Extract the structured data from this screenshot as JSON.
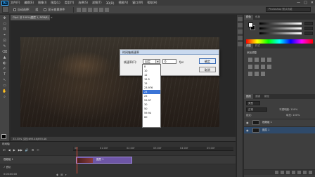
{
  "app": {
    "logo": "Ps"
  },
  "menu": [
    "文件(F)",
    "编辑(E)",
    "图像(I)",
    "图层(L)",
    "类型(Y)",
    "选择(S)",
    "滤镜(T)",
    "3D(D)",
    "视图(V)",
    "窗口(W)",
    "帮助(H)"
  ],
  "window_controls": {
    "min": "—",
    "max": "□",
    "close": "✕"
  },
  "options": {
    "auto_select_label": "自动选择:",
    "auto_select_value": "组",
    "transform_label": "显示变换控件"
  },
  "workspace": "Photoshop 默认功能",
  "document": {
    "tab": "Clip1 @ 100%(图层 1, RGB/8)",
    "close": "×"
  },
  "dialog": {
    "title": "时间轴帧速率",
    "label": "帧速率(F):",
    "select_value": "自定",
    "input_value": "6",
    "unit": "fps",
    "ok": "确定",
    "cancel": "取消"
  },
  "dropdown": {
    "options": [
      "8",
      "10",
      "12",
      "12.5",
      "15",
      "23.976",
      "24",
      "25",
      "29.97",
      "30",
      "50",
      "59.94",
      "60"
    ],
    "selected_index": 6
  },
  "status": "33.33%  文档:693.4K/693.4K",
  "timeline": {
    "tab": "时间轴",
    "controls": [
      "⏮",
      "◀",
      "▶",
      "▶▶",
      "🔊",
      "⚙",
      "✂"
    ],
    "ruler": [
      "00",
      "01:00f",
      "02:00f",
      "03:00f",
      "04:00f",
      "05:00f"
    ],
    "track": "视频组 1",
    "clip": "图层 1",
    "audio": "♪ 音轨",
    "time": "0:00:00:00",
    "bottom_icons": [
      "◈",
      "⊞",
      "⌕"
    ]
  },
  "panels": {
    "color_tabs": [
      "颜色",
      "色板"
    ],
    "adj_tabs": [
      "调整",
      "样式"
    ],
    "adj_title": "添加调整",
    "layer_tabs": [
      "图层",
      "通道",
      "路径"
    ],
    "layer_kind": "类型",
    "layer_mode": "正常",
    "layer_opacity": "不透明度: 100%",
    "layer_lock": "锁定:",
    "layer_fill": "填充: 100%",
    "layers": [
      {
        "name": "视频组 1",
        "visible": "◉"
      },
      {
        "name": "图层 1",
        "visible": "◉"
      }
    ]
  },
  "tools": [
    "✥",
    "▭",
    "ʘ",
    "⌖",
    "⊡",
    "✎",
    "⌫",
    "▲",
    "◐",
    "✍",
    "T",
    "↖",
    "▭",
    "✋",
    "⌕"
  ]
}
